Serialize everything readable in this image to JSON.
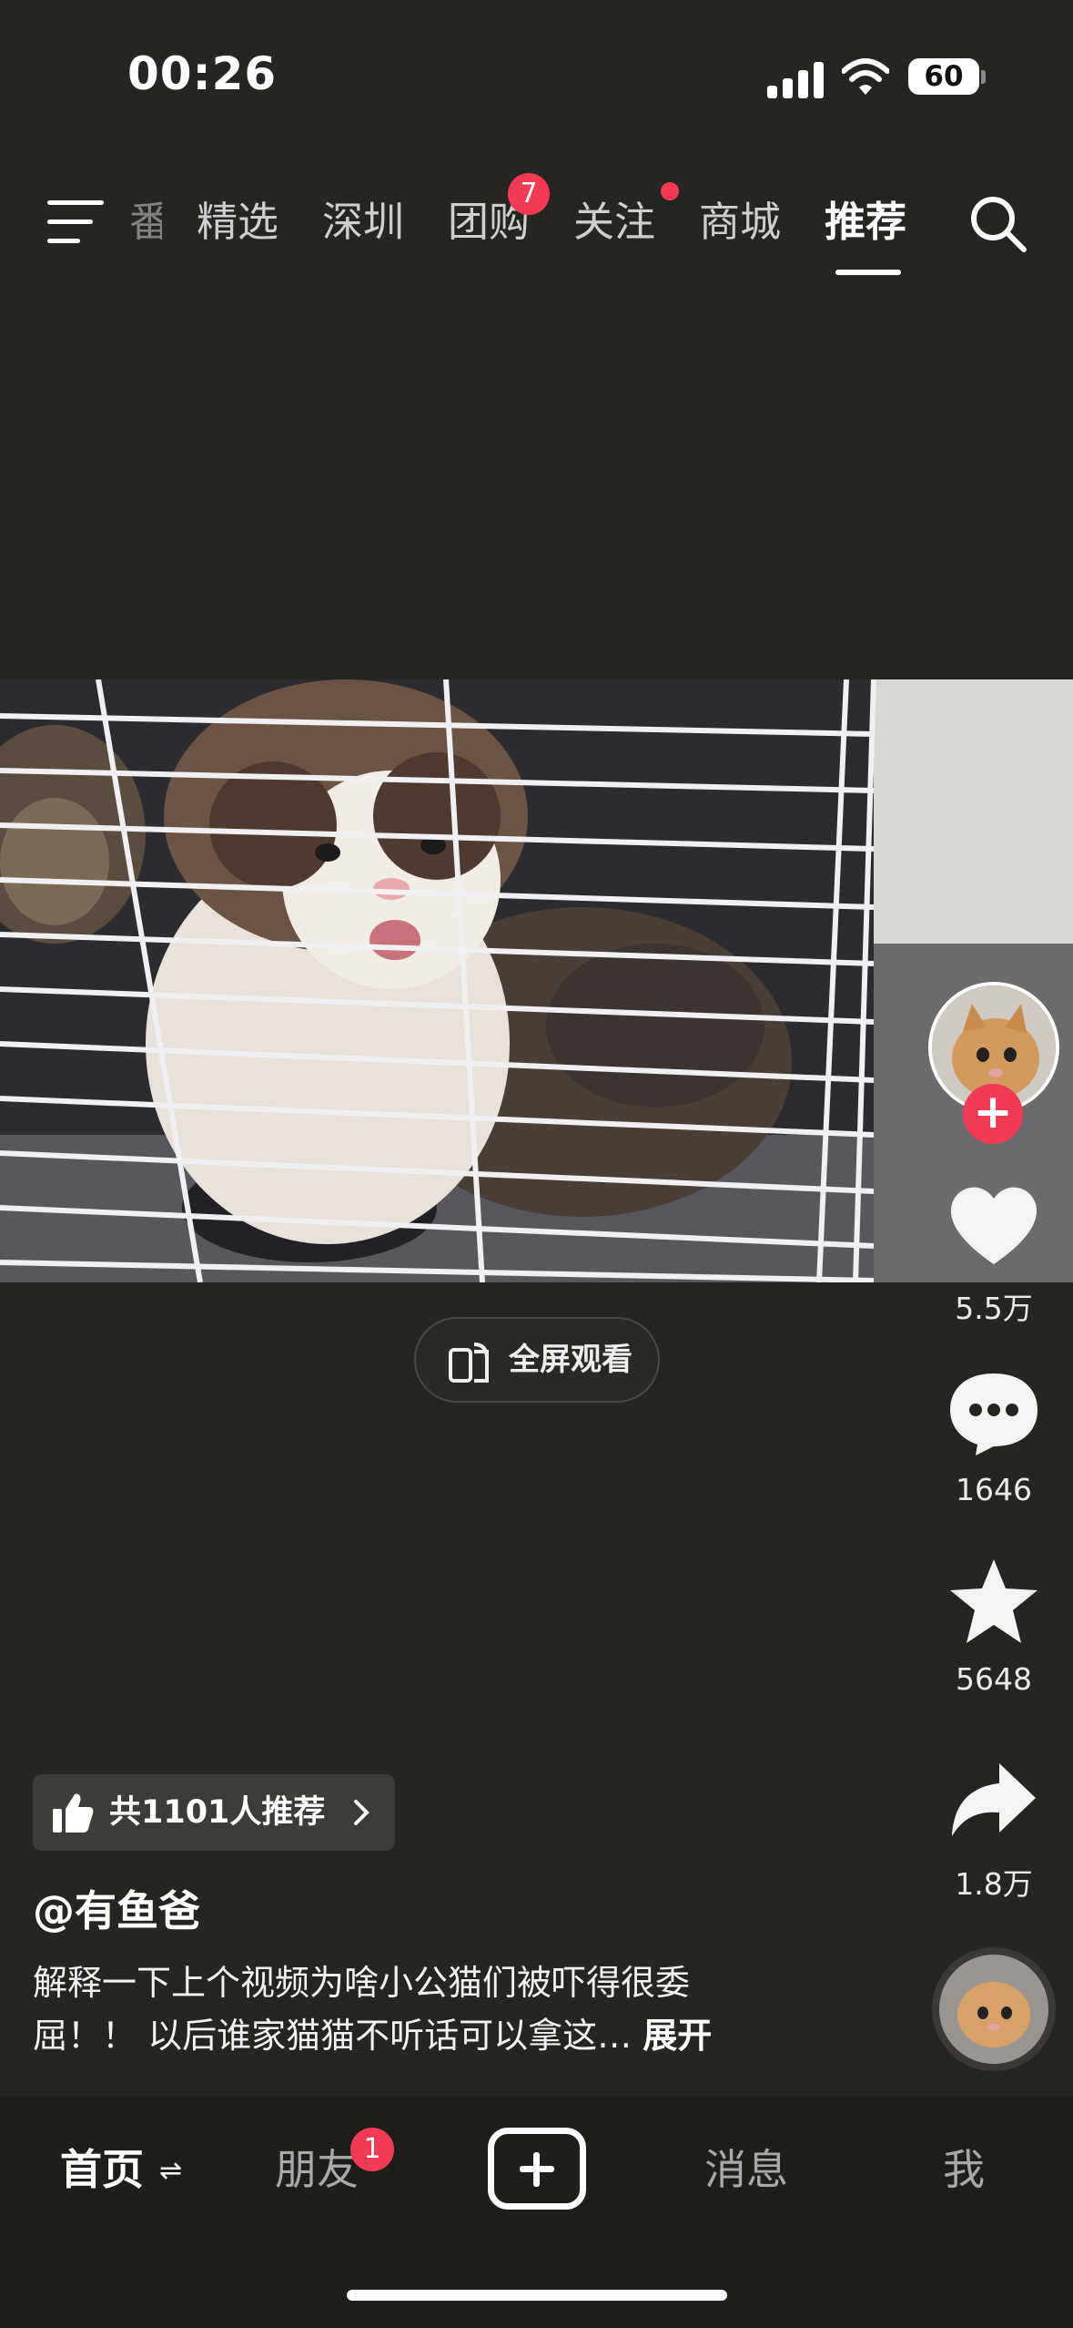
{
  "status": {
    "time": "00:26",
    "battery": "60"
  },
  "topnav": {
    "partial_tab": "番",
    "tabs": [
      {
        "label": "精选"
      },
      {
        "label": "深圳"
      },
      {
        "label": "团购",
        "badge": "7"
      },
      {
        "label": "关注"
      },
      {
        "label": "商城"
      },
      {
        "label": "推荐"
      }
    ]
  },
  "video": {
    "fullscreen_label": "全屏观看"
  },
  "actions": {
    "likes": "5.5万",
    "comments": "1646",
    "favorites": "5648",
    "shares": "1.8万"
  },
  "post": {
    "recommend_text": "共1101人推荐",
    "author": "@有鱼爸",
    "description_line1": "解释一下上个视频为啥小公猫们被吓得很委",
    "description_line2": "屈！！ 以后谁家猫猫不听话可以拿这…",
    "expand": "展开"
  },
  "tabbar": {
    "home": "首页",
    "friends": "朋友",
    "friends_badge": "1",
    "messages": "消息",
    "me": "我"
  },
  "colors": {
    "background": "#262521",
    "accent": "#f23a53"
  }
}
